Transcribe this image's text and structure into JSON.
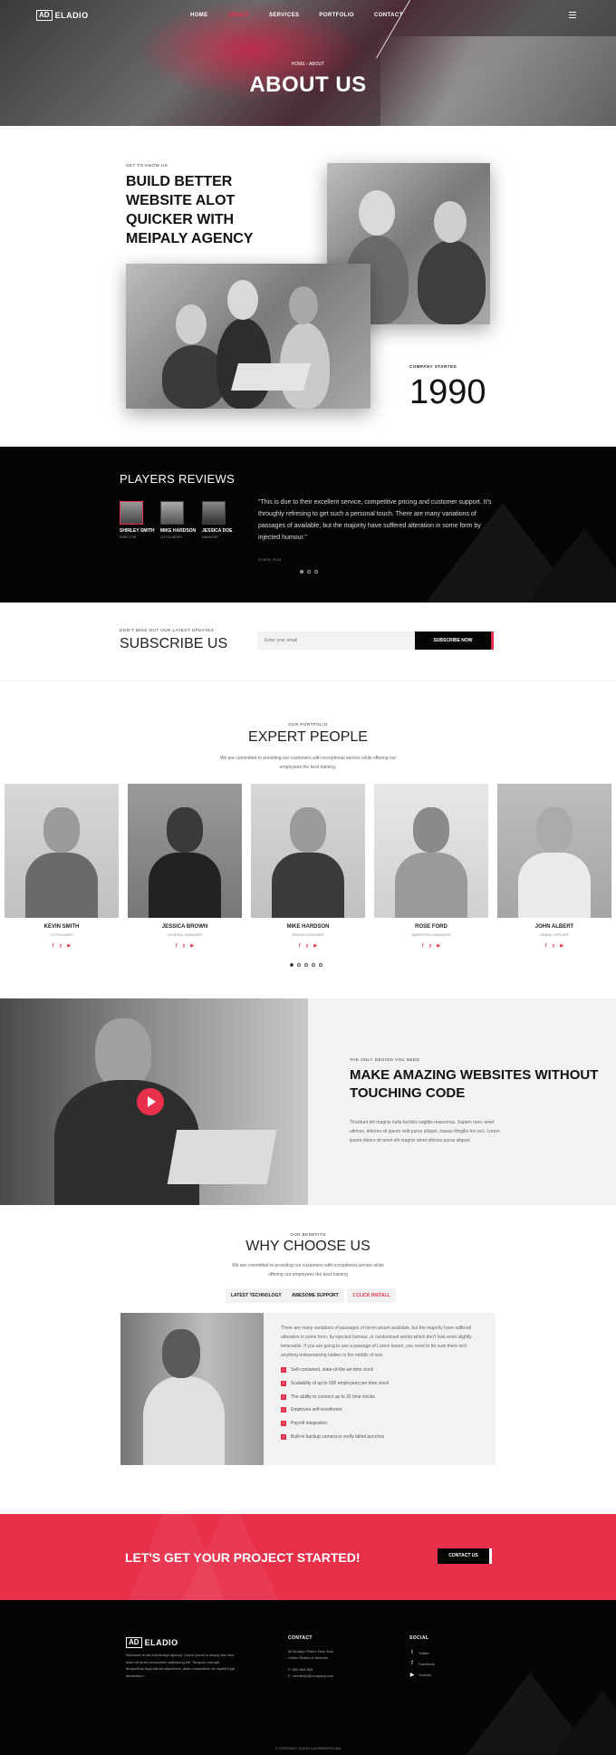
{
  "brand": {
    "badge": "AD",
    "name": "ELADIO"
  },
  "nav": {
    "items": [
      "HOME",
      "ABOUT",
      "SERVICES",
      "PORTFOLIO",
      "CONTACT"
    ],
    "active": "ABOUT"
  },
  "hero": {
    "breadcrumb_home": "HOME",
    "breadcrumb_sep": "›",
    "breadcrumb_current": "ABOUT",
    "title": "ABOUT US"
  },
  "about": {
    "eyebrow": "GET TO KNOW US",
    "heading": "BUILD BETTER WEBSITE ALOT QUICKER WITH MEIPALY AGENCY",
    "started_label": "COMPANY STARTED",
    "started_year": "1990"
  },
  "reviews": {
    "title": "PLAYERS REVIEWS",
    "people": [
      {
        "name": "SHIRLEY SMITH",
        "role": "DIRECTOR"
      },
      {
        "name": "MIKE HARDSON",
        "role": "CO-FOUNDER"
      },
      {
        "name": "JESSICA DOE",
        "role": "MANAGER"
      }
    ],
    "quote": "\"This is due to their excellent service, competitive pricing and customer support. It's throughly refresing to get such a personal touch. There are many variations of passages of available, but the majority have suffered alteration in some form by injected humour.\"",
    "date": "20 NOV, 2018"
  },
  "subscribe": {
    "eyebrow": "DON'T MISS OUT OUR LATEST UPDATES",
    "title": "SUBSCRIBE US",
    "placeholder": "Enter your email",
    "button": "SUBSCRIBE NOW"
  },
  "team": {
    "eyebrow": "OUR PORTFOLIO",
    "title": "EXPERT PEOPLE",
    "intro": "We are committed to providing our customers with exceptional service while offering our employees the best training.",
    "members": [
      {
        "name": "KEVIN SMITH",
        "role": "CO FOUNDER"
      },
      {
        "name": "JESSICA BROWN",
        "role": "GENERAL MANAGER"
      },
      {
        "name": "MIKE HARDSON",
        "role": "SENIOR DESIGNER"
      },
      {
        "name": "ROSE FORD",
        "role": "MARKETING MANAGER"
      },
      {
        "name": "JOHN ALBERT",
        "role": "BRAND OFFICER"
      }
    ],
    "social": [
      "f",
      "y",
      "▶"
    ]
  },
  "video": {
    "eyebrow": "THE ONLY DESIGN YOU NEED",
    "heading": "MAKE AMAZING WEBSITES WITHOUT TOUCHING CODE",
    "text": "Tincidunt elit magnis nulla facilisis sagittis maecenas. Sapien nunc amet ultrices, dolores sit ipsum velit purus aliquet, massa fringilla leo orci. Lorem ipsum dolors sit amet elit magnis amet ultrices purus aliquet."
  },
  "why": {
    "eyebrow": "OUR BENEFITS",
    "title": "WHY CHOOSE US",
    "intro": "We are committed to providing our customers with exceptional service while offering our employees the best training",
    "tabs": [
      "LATEST TECHNOLOGY",
      "AWESOME SUPPORT",
      "1 CLICK INSTALL"
    ],
    "active_tab": "1 CLICK INSTALL",
    "text": "There are many variations of passages of lorem ipsum available, but the majority have suffered alteration in some form, by injected humour, or randomised words which don't look even slightly believable. If you are going to use a passage of Lorem Ipsum, you need to be sure there isn't anything embarrassing hidden in the middle of text.",
    "features": [
      "Self-contained, state-of-the-art time clock",
      "Scalability of up to 500 employees per time clock",
      "The ability to connect up to 32 time clocks",
      "Employee self-enrollment",
      "Payroll integration",
      "Built-in backup camera to verify failed punches"
    ]
  },
  "cta": {
    "title": "LET'S GET YOUR PROJECT STARTED!",
    "button": "CONTACT US"
  },
  "footer": {
    "about": "Welcome to we and design agency. Lorem ipsum is simply free text dolor sit amet consectetur adipiscing elit. Tempore corrupti temporibus fuga earum asperiores, alias consectetur sit repellit fugit laudantium.",
    "contact_title": "CONTACT",
    "address": "66 Broklyn Street, New York",
    "country": "United States of America",
    "phone": "P: 650 864 565",
    "email": "E: needhelp@company.com",
    "social_title": "SOCIAL",
    "social": [
      {
        "icon": "twitter-icon",
        "glyph": "t",
        "label": "Twitter"
      },
      {
        "icon": "facebook-icon",
        "glyph": "f",
        "label": "Facebook"
      },
      {
        "icon": "youtube-icon",
        "glyph": "▶",
        "label": "Youtube"
      }
    ],
    "copyright": "© COPYRIGHT 2018 BY LAYERDROPS.COM"
  },
  "colors": {
    "accent": "#e8304a",
    "dark": "#050505",
    "light": "#f2f2f2"
  }
}
